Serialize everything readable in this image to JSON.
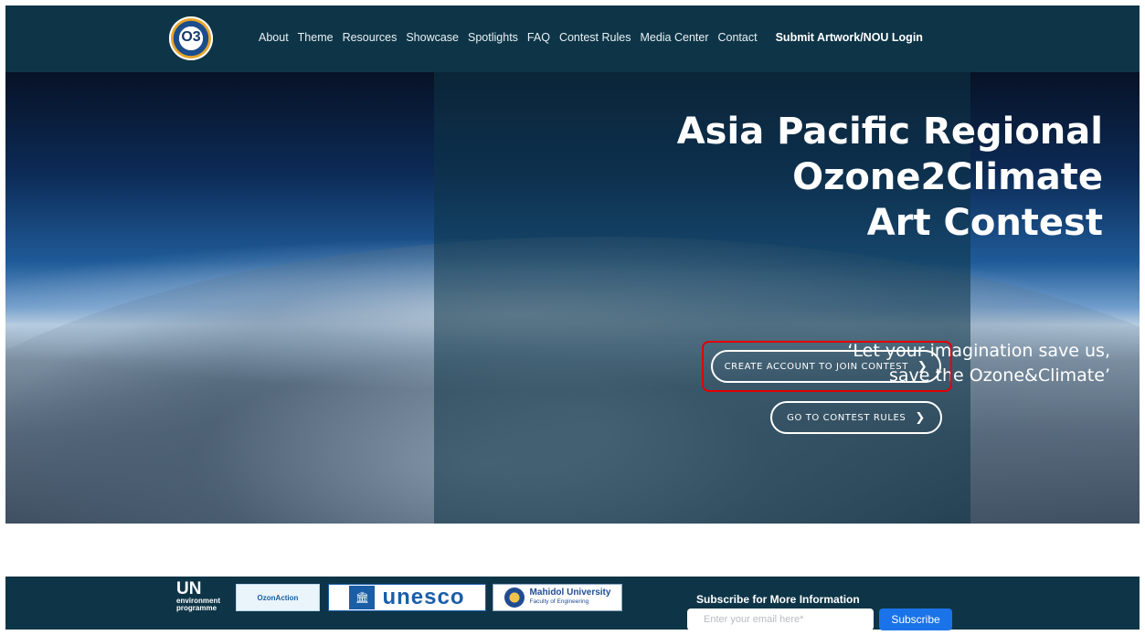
{
  "nav": {
    "items": [
      "About",
      "Theme",
      "Resources",
      "Showcase",
      "Spotlights",
      "FAQ",
      "Contest Rules",
      "Media Center",
      "Contact"
    ],
    "login": "Submit Artwork/NOU Login"
  },
  "logo": {
    "text": "O3"
  },
  "hero": {
    "title_lines": [
      "Asia Pacific Regional",
      "Ozone2Climate",
      "Art Contest"
    ],
    "tagline_lines": [
      "‘Let your imagination save us,",
      "save the Ozone&Climate’"
    ],
    "create_button": "CREATE ACCOUNT TO JOIN CONTEST",
    "rules_button": "GO TO CONTEST RULES"
  },
  "footer": {
    "un_logo": {
      "top": "UN",
      "line1": "environment",
      "line2": "programme"
    },
    "ozonaction": "OzonAction",
    "unesco": "unesco",
    "mahidol": {
      "name": "Mahidol University",
      "faculty": "Faculty of Engineering"
    },
    "subscribe_title": "Subscribe for More Information",
    "email_placeholder": "Enter your email here*",
    "subscribe_button": "Subscribe"
  },
  "colors": {
    "nav_bg": "#0e3547",
    "subscribe_bg": "#1a73e8",
    "highlight": "#e10000"
  },
  "icons": [
    "chevron-right-icon"
  ]
}
